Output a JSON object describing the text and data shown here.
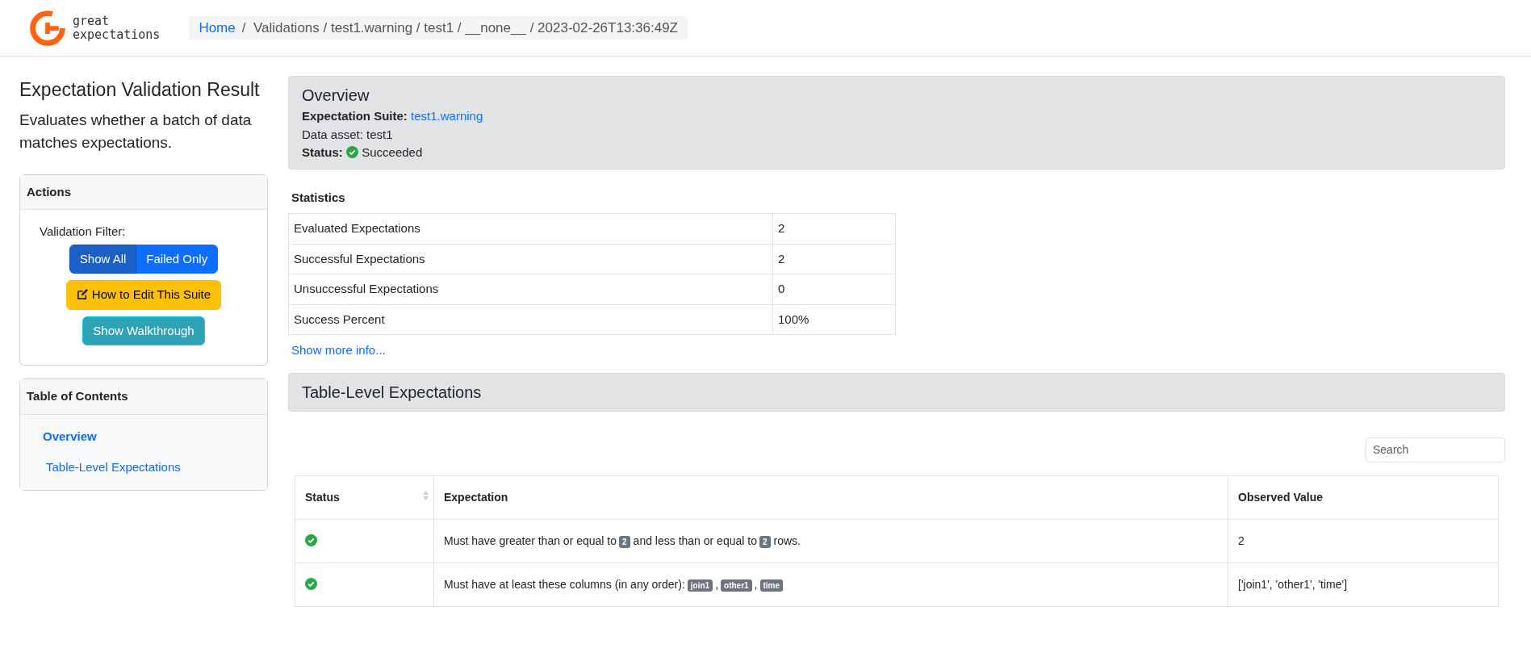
{
  "header": {
    "brand": "great\nexpectations",
    "breadcrumb": [
      {
        "text": "Home",
        "kind": "link"
      },
      {
        "text": "/  Validations / test1.warning / test1 / __none__ / 2023-02-26T13:36:49Z",
        "kind": "text"
      }
    ]
  },
  "sidebar": {
    "title": "Expectation Validation Result",
    "subtitle": "Evaluates whether a batch of data matches expectations.",
    "actions": {
      "title": "Actions",
      "filter_label": "Validation Filter:",
      "filter_buttons": [
        {
          "label": "Show All",
          "selected": true
        },
        {
          "label": "Failed Only",
          "selected": false
        }
      ],
      "edit_button": "How to Edit This Suite",
      "walkthrough_button": "Show Walkthrough"
    },
    "toc": {
      "title": "Table of Contents",
      "items": [
        {
          "label": "Overview",
          "selected": true
        },
        {
          "label": "Table-Level Expectations",
          "selected": false
        }
      ]
    }
  },
  "overview": {
    "title": "Overview",
    "suite_label": "Expectation Suite:",
    "suite": "test1.warning",
    "asset": "Data asset: test1",
    "status_label": "Status:",
    "kind": "success",
    "status_text": "Succeeded"
  },
  "statistics": {
    "title": "Statistics",
    "rows": [
      [
        "Evaluated Expectations",
        "2"
      ],
      [
        "Successful Expectations",
        "2"
      ],
      [
        "Unsuccessful Expectations",
        "0"
      ],
      [
        "Success Percent",
        "100%"
      ]
    ],
    "more": "Show more info..."
  },
  "section": {
    "title": "Table-Level Expectations",
    "search": {
      "placeholder": "Search"
    },
    "columns": [
      "Status",
      "Expectation",
      "Observed Value"
    ],
    "rows": [
      {
        "kind": "success",
        "parts": [
          {
            "kind": "text",
            "text": "Must have greater than or equal to"
          },
          {
            "kind": "badge",
            "text": "2"
          },
          {
            "kind": "text",
            "text": "and less than or equal to"
          },
          {
            "kind": "badge",
            "text": "2"
          },
          {
            "kind": "text",
            "text": "rows."
          }
        ],
        "observed": "2"
      },
      {
        "kind": "success",
        "parts": [
          {
            "kind": "text",
            "text": "Must have at least these columns (in any order):"
          },
          {
            "kind": "badge",
            "text": "join1"
          },
          {
            "kind": "text",
            "text": ","
          },
          {
            "kind": "badge",
            "text": "other1"
          },
          {
            "kind": "text",
            "text": ","
          },
          {
            "kind": "badge",
            "text": "time"
          }
        ],
        "observed": "['join1', 'other1', 'time']"
      }
    ]
  }
}
